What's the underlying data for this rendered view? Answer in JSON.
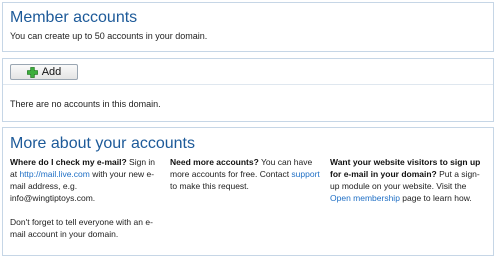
{
  "header": {
    "title": "Member accounts",
    "subtitle": "You can create up to 50 accounts in your domain."
  },
  "toolbar": {
    "add_label": "Add",
    "empty_message": "There are no accounts in this domain."
  },
  "more": {
    "title": "More about your accounts",
    "col1": {
      "heading": "Where do I check my e-mail?",
      "t1": " Sign in at ",
      "link": "http://mail.live.com",
      "t2": " with your new e-mail address, e.g. info@wingtiptoys.com.",
      "p2": "Don't forget to tell everyone with an e-mail account in your domain."
    },
    "col2": {
      "heading": "Need more accounts?",
      "t1": " You can have more accounts for free. Contact ",
      "link": "support",
      "t2": " to make this request."
    },
    "col3": {
      "heading": "Want your website visitors to sign up for e-mail in your domain?",
      "t1": " Put a sign-up module on your website. Visit the ",
      "link": "Open membership",
      "t2": " page to learn how."
    }
  },
  "colors": {
    "title": "#1d5a99",
    "link": "#1f6fc5",
    "border": "#c6d6e6",
    "plus": "#3cae3c"
  }
}
